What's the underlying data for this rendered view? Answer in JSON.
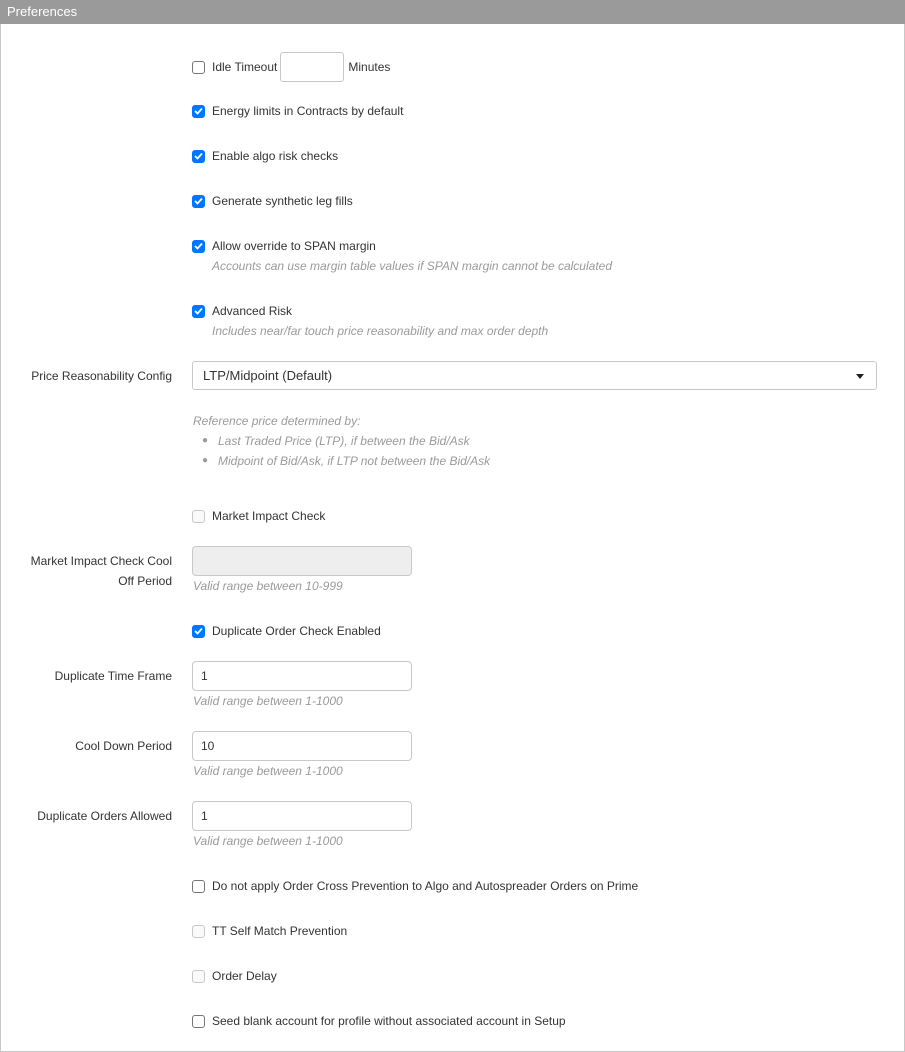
{
  "panel": {
    "title": "Preferences"
  },
  "idle_timeout": {
    "label": "Idle Timeout",
    "value": "",
    "unit": "Minutes",
    "checked": false
  },
  "energy_limits": {
    "label": "Energy limits in Contracts by default",
    "checked": true
  },
  "algo_risk": {
    "label": "Enable algo risk checks",
    "checked": true
  },
  "synthetic_leg": {
    "label": "Generate synthetic leg fills",
    "checked": true
  },
  "span_override": {
    "label": "Allow override to SPAN margin",
    "help": "Accounts can use margin table values if SPAN margin cannot be calculated",
    "checked": true
  },
  "advanced_risk": {
    "label": "Advanced Risk",
    "help": "Includes near/far touch price reasonability and max order depth",
    "checked": true
  },
  "price_reasonability": {
    "label": "Price Reasonability Config",
    "selected": "LTP/Midpoint (Default)",
    "ref_title": "Reference price determined by:",
    "ref_items": [
      "Last Traded Price (LTP), if between the Bid/Ask",
      "Midpoint of Bid/Ask, if LTP not between the Bid/Ask"
    ]
  },
  "market_impact": {
    "label": "Market Impact Check",
    "checked": false,
    "disabled": true
  },
  "market_impact_cool_off": {
    "label_line1": "Market Impact Check Cool",
    "label_line2": "Off Period",
    "value": "",
    "help": "Valid range between 10-999"
  },
  "duplicate_check": {
    "label": "Duplicate Order Check Enabled",
    "checked": true
  },
  "duplicate_time_frame": {
    "label": "Duplicate Time Frame",
    "value": "1",
    "help": "Valid range between 1-1000"
  },
  "cool_down_period": {
    "label": "Cool Down Period",
    "value": "10",
    "help": "Valid range between 1-1000"
  },
  "duplicate_orders_allowed": {
    "label": "Duplicate Orders Allowed",
    "value": "1",
    "help": "Valid range between 1-1000"
  },
  "cross_prevention": {
    "label": "Do not apply Order Cross Prevention to Algo and Autospreader Orders on Prime",
    "checked": false
  },
  "self_match": {
    "label": "TT Self Match Prevention",
    "checked": false,
    "disabled": true
  },
  "order_delay": {
    "label": "Order Delay",
    "checked": false,
    "disabled": true
  },
  "seed_blank": {
    "label": "Seed blank account for profile without associated account in Setup",
    "checked": false
  },
  "colors": {
    "title_bar": "#9a9a9a",
    "checkbox_checked": "#0075ff",
    "help_text": "#9a9a9a"
  }
}
